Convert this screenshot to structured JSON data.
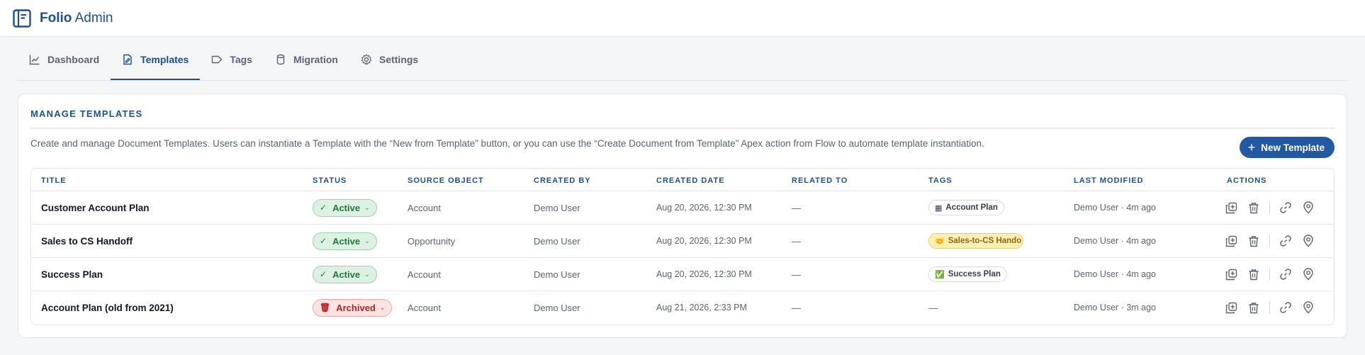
{
  "brand": {
    "name_bold": "Folio",
    "name_rest": "Admin"
  },
  "tabs": [
    {
      "label": "Dashboard",
      "icon": "chart-line-icon",
      "active": false
    },
    {
      "label": "Templates",
      "icon": "template-icon",
      "active": true
    },
    {
      "label": "Tags",
      "icon": "tag-icon",
      "active": false
    },
    {
      "label": "Migration",
      "icon": "database-icon",
      "active": false
    },
    {
      "label": "Settings",
      "icon": "gear-icon",
      "active": false
    }
  ],
  "panel": {
    "title": "MANAGE TEMPLATES",
    "description": "Create and manage Document Templates. Users can instantiate a Template with the “New from Template” button, or you can use the “Create Document from Template” Apex action from Flow to automate template instantiation.",
    "new_button": {
      "icon": "+",
      "label": "New Template"
    }
  },
  "table": {
    "headers": {
      "title": "TITLE",
      "status": "STATUS",
      "source": "SOURCE OBJECT",
      "created_by": "CREATED BY",
      "created_date": "CREATED DATE",
      "related": "RELATED TO",
      "tags": "TAGS",
      "last_modified": "LAST MODIFIED",
      "actions": "ACTIONS"
    },
    "rows": [
      {
        "title": "Customer Account Plan",
        "status": {
          "label": "Active",
          "kind": "active",
          "icon": "✓",
          "chevron": "⌄"
        },
        "source": "Account",
        "created_by": "Demo User",
        "created_date": "Aug 20, 2026, 12:30 PM",
        "related": "—",
        "tag": {
          "emoji": "▦",
          "label": "Account Plan",
          "style": "plain"
        },
        "last_modified": "Demo User · 4m ago"
      },
      {
        "title": "Sales to CS Handoff",
        "status": {
          "label": "Active",
          "kind": "active",
          "icon": "✓",
          "chevron": "⌄"
        },
        "source": "Opportunity",
        "created_by": "Demo User",
        "created_date": "Aug 20, 2026, 12:30 PM",
        "related": "—",
        "tag": {
          "emoji": "🤝",
          "label": "Sales-to-CS Hando",
          "style": "yellow"
        },
        "last_modified": "Demo User · 4m ago"
      },
      {
        "title": "Success Plan",
        "status": {
          "label": "Active",
          "kind": "active",
          "icon": "✓",
          "chevron": "⌄"
        },
        "source": "Account",
        "created_by": "Demo User",
        "created_date": "Aug 20, 2026, 12:30 PM",
        "related": "—",
        "tag": {
          "emoji": "✅",
          "label": "Success Plan",
          "style": "plain"
        },
        "last_modified": "Demo User · 4m ago"
      },
      {
        "title": "Account Plan (old from 2021)",
        "status": {
          "label": "Archived",
          "kind": "archived",
          "icon": "🗑",
          "chevron": "⌄"
        },
        "source": "Account",
        "created_by": "Demo User",
        "created_date": "Aug 21, 2026, 2:33 PM",
        "related": "—",
        "tag": null,
        "tag_empty": "—",
        "last_modified": "Demo User · 3m ago"
      }
    ]
  },
  "colors": {
    "accent": "#1d4f91",
    "button": "#2359a3",
    "active_bg": "#dcf1e2",
    "archived_bg": "#fde2e2",
    "tag_yellow": "#fbeeb5"
  }
}
